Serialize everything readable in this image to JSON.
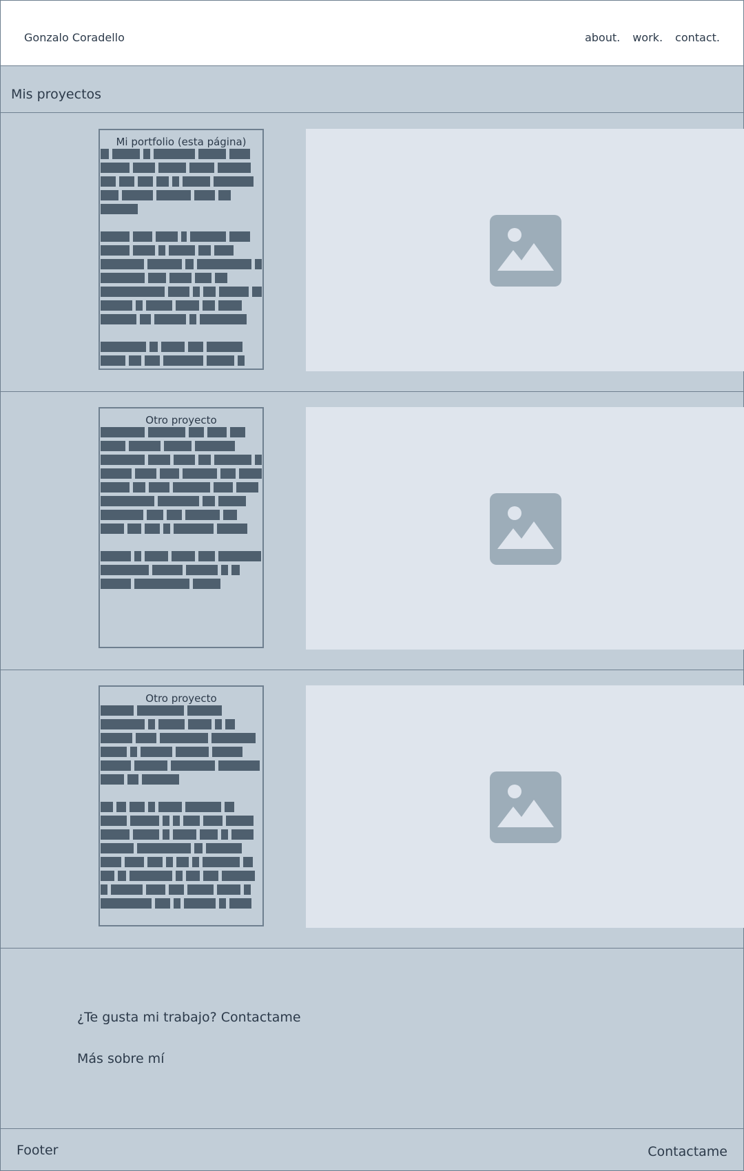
{
  "header": {
    "brand": "Gonzalo Coradello",
    "nav": [
      "about.",
      "work.",
      "contact."
    ]
  },
  "section": {
    "title": "Mis proyectos"
  },
  "projects": [
    {
      "title": "Mi portfolio (esta página)",
      "image_icon": "image-placeholder-icon"
    },
    {
      "title": "Otro proyecto",
      "image_icon": "image-placeholder-icon"
    },
    {
      "title": "Otro proyecto",
      "image_icon": "image-placeholder-icon"
    }
  ],
  "contact": {
    "cta": "¿Te gusta mi trabajo? Contactame",
    "more": "Más sobre mí"
  },
  "footer": {
    "label": "Footer",
    "link": "Contactame"
  },
  "colors": {
    "background": "#c2ced8",
    "header": "#ffffff",
    "media": "#dfe5ed",
    "text_block": "#4e5f6e",
    "icon": "#9dadb9"
  }
}
